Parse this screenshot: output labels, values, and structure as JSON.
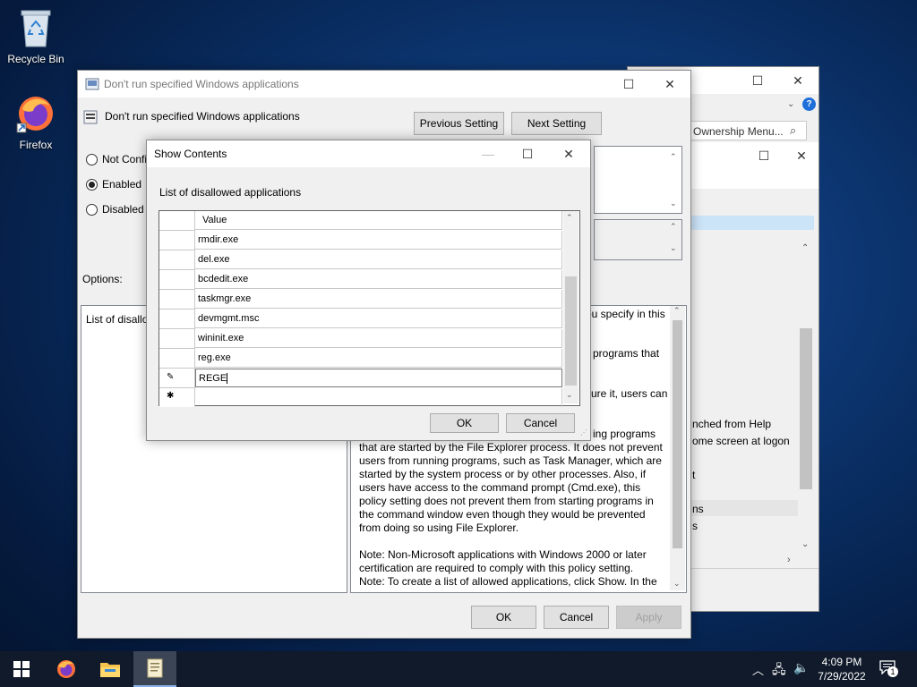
{
  "desktop": {
    "icons": [
      {
        "label": "Recycle Bin",
        "icon": "recycle-bin-icon"
      },
      {
        "label": "Firefox",
        "icon": "firefox-icon"
      }
    ]
  },
  "background_window": {
    "search_text": "Ownership Menu...",
    "items": [
      "nched from Help",
      "ome screen at logon",
      "t",
      "ns",
      "s"
    ]
  },
  "policy_window": {
    "title": "Don't run specified Windows applications",
    "heading": "Don't run specified Windows applications",
    "previous_button": "Previous Setting",
    "next_button": "Next Setting",
    "radios": [
      {
        "label": "Not Configured",
        "visible": "Not Confi",
        "checked": false
      },
      {
        "label": "Enabled",
        "checked": true
      },
      {
        "label": "Disabled",
        "checked": false
      }
    ],
    "options_label": "Options:",
    "options_box_text": "List of disallo",
    "help_fragments": [
      "ou specify in this",
      "programs that",
      "ure it, users can",
      "ing programs"
    ],
    "help_text_lines": [
      "that are started by the File Explorer process. It does not prevent",
      "users from running programs, such as Task Manager, which are",
      "started by the system process or by other processes.  Also, if",
      "users have access to the command prompt (Cmd.exe), this",
      "policy setting does not prevent them from starting programs in",
      "the command window even though they would be prevented",
      "from doing so using File Explorer.",
      "",
      "Note: Non-Microsoft applications with Windows 2000 or later",
      "certification are required to comply with this policy setting.",
      "Note: To create a list of allowed applications, click Show.  In the"
    ],
    "ok": "OK",
    "cancel": "Cancel",
    "apply": "Apply"
  },
  "show_contents": {
    "title": "Show Contents",
    "list_label": "List of disallowed applications",
    "column_header": "Value",
    "rows": [
      "rmdir.exe",
      "del.exe",
      "bcdedit.exe",
      "taskmgr.exe",
      "devmgmt.msc",
      "wininit.exe",
      "reg.exe"
    ],
    "editing_value": "REGE",
    "ok": "OK",
    "cancel": "Cancel"
  },
  "taskbar": {
    "time": "4:09 PM",
    "date": "7/29/2022",
    "notification_count": "1"
  }
}
